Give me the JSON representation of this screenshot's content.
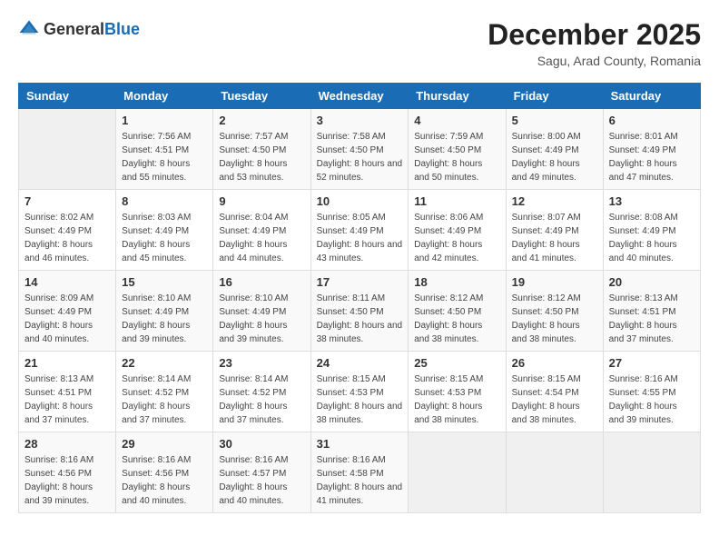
{
  "header": {
    "logo_general": "General",
    "logo_blue": "Blue",
    "month_title": "December 2025",
    "location": "Sagu, Arad County, Romania"
  },
  "days_of_week": [
    "Sunday",
    "Monday",
    "Tuesday",
    "Wednesday",
    "Thursday",
    "Friday",
    "Saturday"
  ],
  "weeks": [
    [
      {
        "day": "",
        "sunrise": "",
        "sunset": "",
        "daylight": "",
        "empty": true
      },
      {
        "day": "1",
        "sunrise": "Sunrise: 7:56 AM",
        "sunset": "Sunset: 4:51 PM",
        "daylight": "Daylight: 8 hours and 55 minutes."
      },
      {
        "day": "2",
        "sunrise": "Sunrise: 7:57 AM",
        "sunset": "Sunset: 4:50 PM",
        "daylight": "Daylight: 8 hours and 53 minutes."
      },
      {
        "day": "3",
        "sunrise": "Sunrise: 7:58 AM",
        "sunset": "Sunset: 4:50 PM",
        "daylight": "Daylight: 8 hours and 52 minutes."
      },
      {
        "day": "4",
        "sunrise": "Sunrise: 7:59 AM",
        "sunset": "Sunset: 4:50 PM",
        "daylight": "Daylight: 8 hours and 50 minutes."
      },
      {
        "day": "5",
        "sunrise": "Sunrise: 8:00 AM",
        "sunset": "Sunset: 4:49 PM",
        "daylight": "Daylight: 8 hours and 49 minutes."
      },
      {
        "day": "6",
        "sunrise": "Sunrise: 8:01 AM",
        "sunset": "Sunset: 4:49 PM",
        "daylight": "Daylight: 8 hours and 47 minutes."
      }
    ],
    [
      {
        "day": "7",
        "sunrise": "Sunrise: 8:02 AM",
        "sunset": "Sunset: 4:49 PM",
        "daylight": "Daylight: 8 hours and 46 minutes."
      },
      {
        "day": "8",
        "sunrise": "Sunrise: 8:03 AM",
        "sunset": "Sunset: 4:49 PM",
        "daylight": "Daylight: 8 hours and 45 minutes."
      },
      {
        "day": "9",
        "sunrise": "Sunrise: 8:04 AM",
        "sunset": "Sunset: 4:49 PM",
        "daylight": "Daylight: 8 hours and 44 minutes."
      },
      {
        "day": "10",
        "sunrise": "Sunrise: 8:05 AM",
        "sunset": "Sunset: 4:49 PM",
        "daylight": "Daylight: 8 hours and 43 minutes."
      },
      {
        "day": "11",
        "sunrise": "Sunrise: 8:06 AM",
        "sunset": "Sunset: 4:49 PM",
        "daylight": "Daylight: 8 hours and 42 minutes."
      },
      {
        "day": "12",
        "sunrise": "Sunrise: 8:07 AM",
        "sunset": "Sunset: 4:49 PM",
        "daylight": "Daylight: 8 hours and 41 minutes."
      },
      {
        "day": "13",
        "sunrise": "Sunrise: 8:08 AM",
        "sunset": "Sunset: 4:49 PM",
        "daylight": "Daylight: 8 hours and 40 minutes."
      }
    ],
    [
      {
        "day": "14",
        "sunrise": "Sunrise: 8:09 AM",
        "sunset": "Sunset: 4:49 PM",
        "daylight": "Daylight: 8 hours and 40 minutes."
      },
      {
        "day": "15",
        "sunrise": "Sunrise: 8:10 AM",
        "sunset": "Sunset: 4:49 PM",
        "daylight": "Daylight: 8 hours and 39 minutes."
      },
      {
        "day": "16",
        "sunrise": "Sunrise: 8:10 AM",
        "sunset": "Sunset: 4:49 PM",
        "daylight": "Daylight: 8 hours and 39 minutes."
      },
      {
        "day": "17",
        "sunrise": "Sunrise: 8:11 AM",
        "sunset": "Sunset: 4:50 PM",
        "daylight": "Daylight: 8 hours and 38 minutes."
      },
      {
        "day": "18",
        "sunrise": "Sunrise: 8:12 AM",
        "sunset": "Sunset: 4:50 PM",
        "daylight": "Daylight: 8 hours and 38 minutes."
      },
      {
        "day": "19",
        "sunrise": "Sunrise: 8:12 AM",
        "sunset": "Sunset: 4:50 PM",
        "daylight": "Daylight: 8 hours and 38 minutes."
      },
      {
        "day": "20",
        "sunrise": "Sunrise: 8:13 AM",
        "sunset": "Sunset: 4:51 PM",
        "daylight": "Daylight: 8 hours and 37 minutes."
      }
    ],
    [
      {
        "day": "21",
        "sunrise": "Sunrise: 8:13 AM",
        "sunset": "Sunset: 4:51 PM",
        "daylight": "Daylight: 8 hours and 37 minutes."
      },
      {
        "day": "22",
        "sunrise": "Sunrise: 8:14 AM",
        "sunset": "Sunset: 4:52 PM",
        "daylight": "Daylight: 8 hours and 37 minutes."
      },
      {
        "day": "23",
        "sunrise": "Sunrise: 8:14 AM",
        "sunset": "Sunset: 4:52 PM",
        "daylight": "Daylight: 8 hours and 37 minutes."
      },
      {
        "day": "24",
        "sunrise": "Sunrise: 8:15 AM",
        "sunset": "Sunset: 4:53 PM",
        "daylight": "Daylight: 8 hours and 38 minutes."
      },
      {
        "day": "25",
        "sunrise": "Sunrise: 8:15 AM",
        "sunset": "Sunset: 4:53 PM",
        "daylight": "Daylight: 8 hours and 38 minutes."
      },
      {
        "day": "26",
        "sunrise": "Sunrise: 8:15 AM",
        "sunset": "Sunset: 4:54 PM",
        "daylight": "Daylight: 8 hours and 38 minutes."
      },
      {
        "day": "27",
        "sunrise": "Sunrise: 8:16 AM",
        "sunset": "Sunset: 4:55 PM",
        "daylight": "Daylight: 8 hours and 39 minutes."
      }
    ],
    [
      {
        "day": "28",
        "sunrise": "Sunrise: 8:16 AM",
        "sunset": "Sunset: 4:56 PM",
        "daylight": "Daylight: 8 hours and 39 minutes."
      },
      {
        "day": "29",
        "sunrise": "Sunrise: 8:16 AM",
        "sunset": "Sunset: 4:56 PM",
        "daylight": "Daylight: 8 hours and 40 minutes."
      },
      {
        "day": "30",
        "sunrise": "Sunrise: 8:16 AM",
        "sunset": "Sunset: 4:57 PM",
        "daylight": "Daylight: 8 hours and 40 minutes."
      },
      {
        "day": "31",
        "sunrise": "Sunrise: 8:16 AM",
        "sunset": "Sunset: 4:58 PM",
        "daylight": "Daylight: 8 hours and 41 minutes."
      },
      {
        "day": "",
        "sunrise": "",
        "sunset": "",
        "daylight": "",
        "empty": true
      },
      {
        "day": "",
        "sunrise": "",
        "sunset": "",
        "daylight": "",
        "empty": true
      },
      {
        "day": "",
        "sunrise": "",
        "sunset": "",
        "daylight": "",
        "empty": true
      }
    ]
  ]
}
